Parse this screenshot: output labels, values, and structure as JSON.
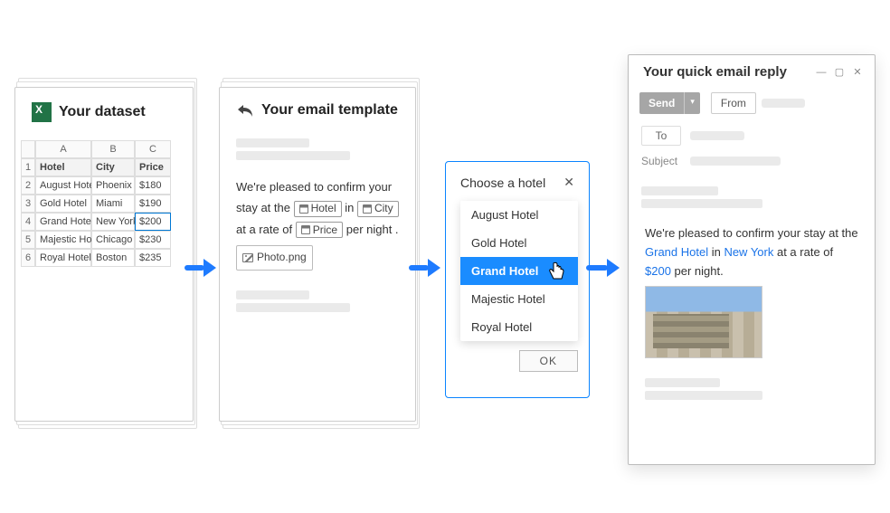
{
  "stage1": {
    "title": "Your dataset",
    "columns": [
      "A",
      "B",
      "C"
    ],
    "headers": {
      "hotel": "Hotel",
      "city": "City",
      "price": "Price"
    },
    "rows": [
      {
        "n": "1",
        "hotel": "August Hotel",
        "city": "Phoenix",
        "price": "$180"
      },
      {
        "n": "2",
        "hotel": "Gold Hotel",
        "city": "Miami",
        "price": "$190"
      },
      {
        "n": "3",
        "hotel": "Grand Hotel",
        "city": "New York",
        "price": "$200",
        "highlight": true
      },
      {
        "n": "4",
        "hotel": "Majestic Hotel",
        "city": "Chicago",
        "price": "$230"
      },
      {
        "n": "5",
        "hotel": "Royal Hotel",
        "city": "Boston",
        "price": "$235"
      }
    ]
  },
  "stage2": {
    "title": "Your email template",
    "text": {
      "part1": "We're pleased to confirm your stay at the ",
      "field_hotel": "Hotel",
      "part2": " in ",
      "field_city": "City",
      "part3": "at a rate of ",
      "field_price": "Price",
      "part4": " per night .",
      "photo_chip": "Photo.png"
    }
  },
  "stage3": {
    "title": "Choose a hotel",
    "options": [
      "August Hotel",
      "Gold Hotel",
      "Grand Hotel",
      "Majestic Hotel",
      "Royal Hotel"
    ],
    "selected_index": 2,
    "ok": "OK"
  },
  "stage4": {
    "title": "Your quick email reply",
    "send": "Send",
    "from": "From",
    "to": "To",
    "subject": "Subject",
    "body": {
      "part1": "We're pleased to confirm your stay at the ",
      "hotel": "Grand Hotel",
      "part2": " in ",
      "city": "New York",
      "part3": " at a rate of ",
      "price": "$200",
      "part4": " per night."
    }
  }
}
